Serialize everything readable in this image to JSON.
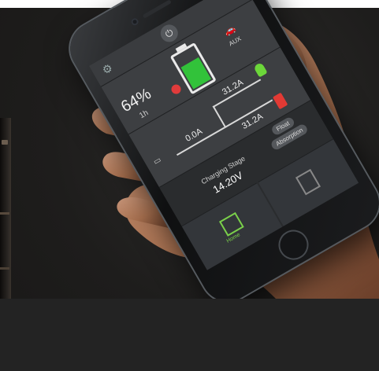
{
  "photo": {
    "description": "",
    "subject_colors": {
      "background": "#1e1d1c",
      "skin": "#b07b5b",
      "phone_body": "#141517",
      "screen_bg": "#2c2e30",
      "accent_green": "#32c23a",
      "accent_red": "#e23a34"
    }
  },
  "app": {
    "battery_percent": "64%",
    "battery_time": "1h",
    "aux_label": "AUX",
    "current_top": "31.2A",
    "current_left": "0.0A",
    "current_bottom": "31.2A",
    "charging_stage_label": "Charging Stage",
    "voltage": "14.20V",
    "chip_float": "Float",
    "chip_absorption": "Absorption",
    "tile_left_label": "Home",
    "tile_right_label": ""
  },
  "icons": {
    "gear": "gear-icon",
    "power": "power-icon",
    "car": "car-icon",
    "bulb": "bulb-icon",
    "battery_small": "battery-icon",
    "house": "house-icon",
    "document": "document-icon"
  },
  "fill_level": {
    "battery_fill_fraction": 0.64
  }
}
